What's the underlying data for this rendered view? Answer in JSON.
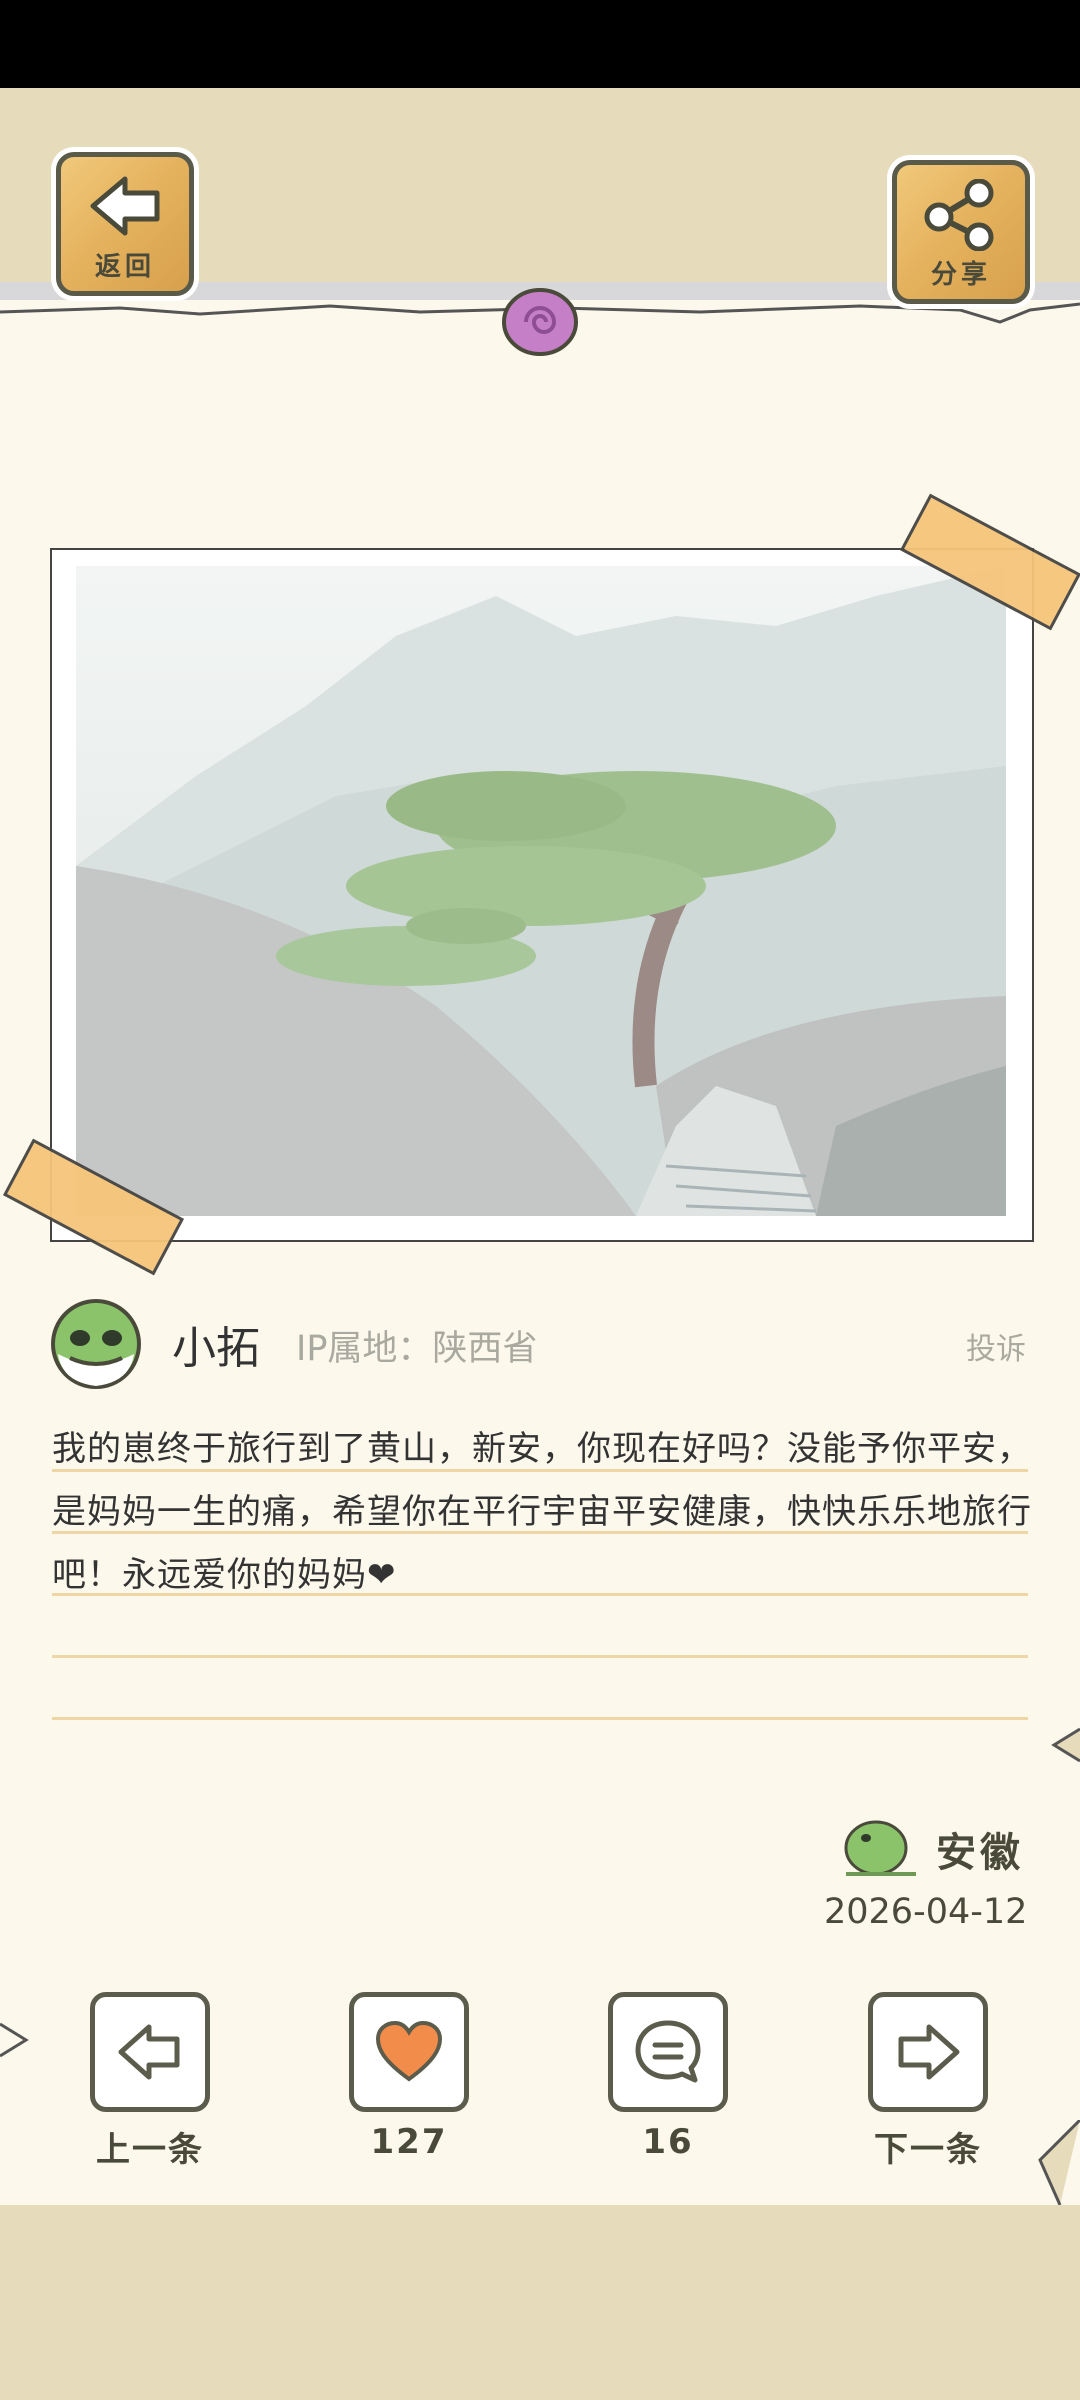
{
  "header": {
    "back_label": "返回",
    "share_label": "分享"
  },
  "post": {
    "author": "小拓",
    "ip_location": "IP属地：陕西省",
    "complaint": "投诉",
    "content": "我的崽终于旅行到了黄山，新安，你现在好吗？没能予你平安，是妈妈一生的痛，希望你在平行宇宙平安健康，快快乐乐地旅行吧！永远爱你的妈妈❤",
    "province": "安徽",
    "date": "2026-04-12"
  },
  "actions": {
    "prev_label": "上一条",
    "likes": "127",
    "comments": "16",
    "next_label": "下一条"
  },
  "colors": {
    "paper": "#fcf8ec",
    "band": "#e6dcbc",
    "tape": "#f6c57a",
    "heart": "#f28c4a",
    "rule_line": "#f0d6a6"
  }
}
